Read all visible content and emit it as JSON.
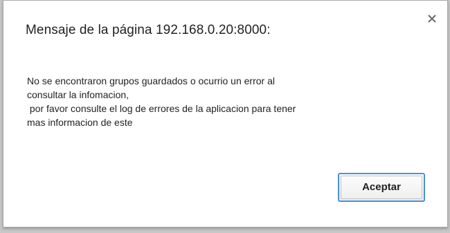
{
  "dialog": {
    "title": "Mensaje de la página 192.168.0.20:8000:",
    "close_icon": "close-icon",
    "message_lines": [
      "No se encontraron grupos guardados o ocurrio un error al",
      "consultar la infomacion,",
      " por favor consulte el log de errores de la aplicacion para tener",
      "mas informacion de este"
    ],
    "accept_label": "Aceptar"
  },
  "colors": {
    "focus_border": "#4a90d9",
    "backdrop": "#c8c8c8"
  }
}
